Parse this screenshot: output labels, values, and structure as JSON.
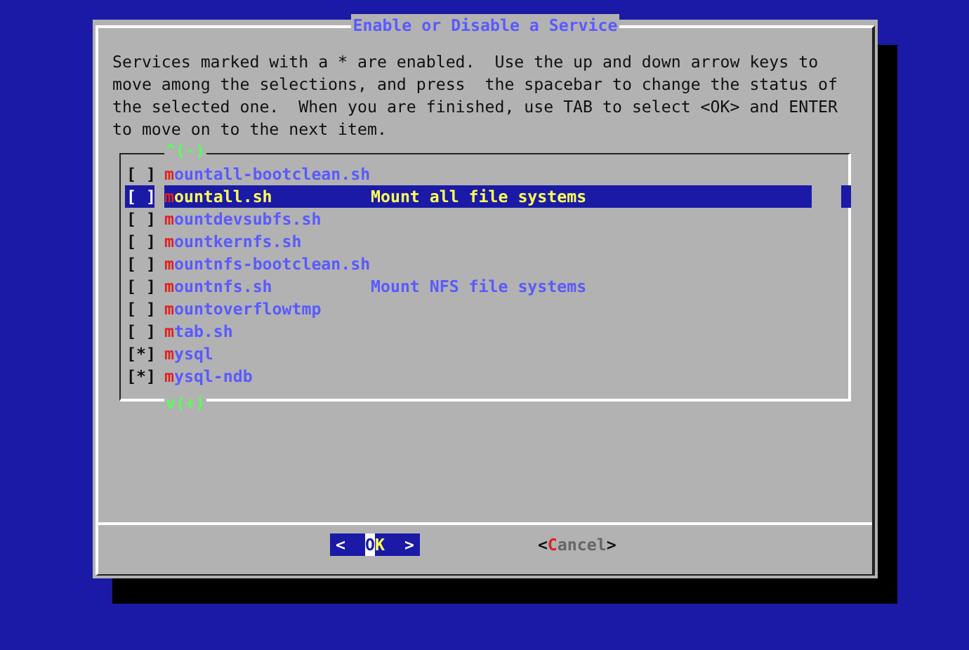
{
  "dialog": {
    "title": "Enable or Disable a Service",
    "message": "Services marked with a * are enabled.  Use the up and down arrow keys to\nmove among the selections, and press  the spacebar to change the status of\nthe selected one.  When you are finished, use TAB to select <OK> and ENTER\nto move on to the next item.",
    "list": {
      "scroll_up": "^(-)",
      "scroll_down": "v(+)",
      "items": [
        {
          "box": "[ ]",
          "name": "mountall-bootclean.sh",
          "selected": false
        },
        {
          "box": "[ ]",
          "name": "mountall.sh",
          "description": "Mount all file systems",
          "selected": true
        },
        {
          "box": "[ ]",
          "name": "mountdevsubfs.sh",
          "selected": false
        },
        {
          "box": "[ ]",
          "name": "mountkernfs.sh",
          "selected": false
        },
        {
          "box": "[ ]",
          "name": "mountnfs-bootclean.sh",
          "selected": false
        },
        {
          "box": "[ ]",
          "name": "mountnfs.sh",
          "description": "Mount NFS file systems",
          "selected": false
        },
        {
          "box": "[ ]",
          "name": "mountoverflowtmp",
          "selected": false
        },
        {
          "box": "[ ]",
          "name": "mtab.sh",
          "selected": false
        },
        {
          "box": "[*]",
          "name": "mysql",
          "selected": false
        },
        {
          "box": "[*]",
          "name": "mysql-ndb",
          "selected": false
        }
      ]
    },
    "buttons": [
      {
        "left": "<",
        "label": "OK",
        "right": ">",
        "selected": true
      },
      {
        "left": "<",
        "label": "Cancel",
        "right": ">",
        "selected": false
      }
    ]
  }
}
